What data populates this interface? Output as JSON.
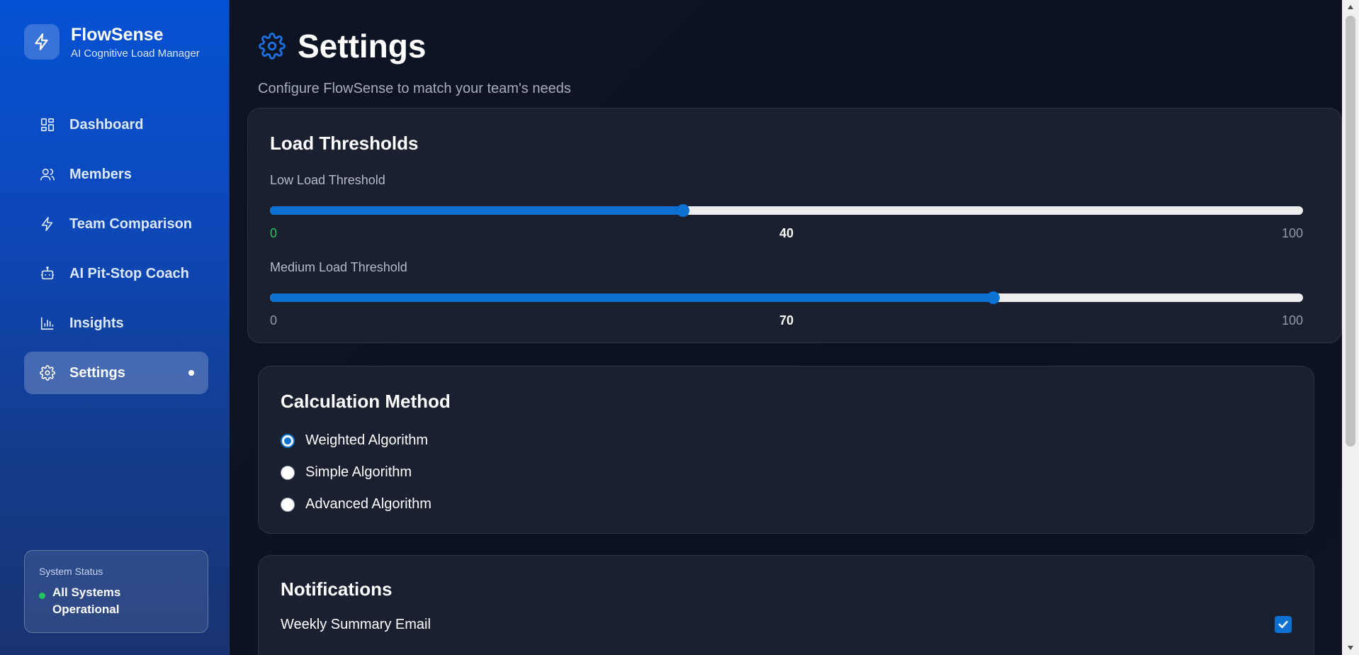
{
  "brand": {
    "name": "FlowSense",
    "tagline": "AI Cognitive Load Manager"
  },
  "sidebar": {
    "items": [
      {
        "label": "Dashboard",
        "icon": "dashboard-grid-icon",
        "active": false
      },
      {
        "label": "Members",
        "icon": "users-icon",
        "active": false
      },
      {
        "label": "Team Comparison",
        "icon": "lightning-icon",
        "active": false
      },
      {
        "label": "AI Pit-Stop Coach",
        "icon": "bot-icon",
        "active": false
      },
      {
        "label": "Insights",
        "icon": "bar-chart-icon",
        "active": false
      },
      {
        "label": "Settings",
        "icon": "gear-icon",
        "active": true
      }
    ],
    "status": {
      "label": "System Status",
      "text": "All Systems Operational",
      "color": "#22c55e"
    }
  },
  "header": {
    "title": "Settings",
    "subtitle": "Configure FlowSense to match your team's needs"
  },
  "thresholds": {
    "title": "Load Thresholds",
    "low": {
      "label": "Low Load Threshold",
      "min": "0",
      "max": "100",
      "value": "40",
      "fraction": 0.4
    },
    "medium": {
      "label": "Medium Load Threshold",
      "min": "0",
      "max": "100",
      "value": "70",
      "fraction": 0.7
    }
  },
  "calculation": {
    "title": "Calculation Method",
    "options": [
      {
        "label": "Weighted Algorithm",
        "selected": true
      },
      {
        "label": "Simple Algorithm",
        "selected": false
      },
      {
        "label": "Advanced Algorithm",
        "selected": false
      }
    ]
  },
  "notifications": {
    "title": "Notifications",
    "weekly": {
      "label": "Weekly Summary Email",
      "checked": true
    }
  },
  "colors": {
    "accent": "#0b72d3",
    "sidebar_top": "#0452d4",
    "background": "#0b1120",
    "success": "#22c55e"
  }
}
